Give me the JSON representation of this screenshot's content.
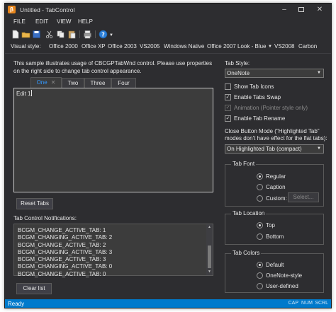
{
  "window": {
    "title": "Untitled - TabControl"
  },
  "menu": [
    "FILE",
    "EDIT",
    "VIEW",
    "HELP"
  ],
  "toolbar": {
    "icons": [
      "new-file-icon",
      "open-folder-icon",
      "save-icon",
      "cut-icon",
      "copy-icon",
      "paste-icon",
      "print-icon",
      "about-icon"
    ]
  },
  "visual_style": {
    "label": "Visual style:",
    "options": [
      "Office 2000",
      "Office XP",
      "Office 2003",
      "VS2005",
      "Windows Native",
      "Office 2007 Look - Blue",
      "VS2008",
      "Carbon"
    ]
  },
  "description": "This sample illustrates usage of CBCGPTabWnd control. Please use properties on the right side to change tab control appearance.",
  "tabs": [
    {
      "label": "One",
      "active": true
    },
    {
      "label": "Two",
      "active": false
    },
    {
      "label": "Three",
      "active": false
    },
    {
      "label": "Four",
      "active": false
    }
  ],
  "editor_text": "Edit 1",
  "reset_tabs_label": "Reset Tabs",
  "notifications": {
    "label": "Tab Control Notifications:",
    "items": [
      "BCGM_CHANGE_ACTIVE_TAB: 1",
      "BCGM_CHANGING_ACTIVE_TAB: 2",
      "BCGM_CHANGE_ACTIVE_TAB: 2",
      "BCGM_CHANGING_ACTIVE_TAB: 3",
      "BCGM_CHANGE_ACTIVE_TAB: 3",
      "BCGM_CHANGING_ACTIVE_TAB: 0",
      "BCGM_CHANGE_ACTIVE_TAB: 0"
    ]
  },
  "clear_list_label": "Clear list",
  "props": {
    "tab_style_label": "Tab Style:",
    "tab_style_value": "OneNote",
    "show_tab_icons": {
      "label": "Show Tab Icons",
      "checked": false
    },
    "enable_tabs_swap": {
      "label": "Enable Tabs Swap",
      "checked": true
    },
    "animation": {
      "label": "Animation (Pointer style only)",
      "checked": true
    },
    "enable_tab_rename": {
      "label": "Enable Tab Rename",
      "checked": true
    },
    "close_mode_label_1": "Close Button Mode (\"Highlighted Tab\"",
    "close_mode_label_2": "modes don't have effect for the flat tabs):",
    "close_mode_value": "On Highlighted Tab (compact)",
    "tab_font": {
      "title": "Tab Font",
      "options": [
        "Regular",
        "Caption",
        "Custom:"
      ],
      "selected": "Regular",
      "select_button": "Select..."
    },
    "tab_location": {
      "title": "Tab Location",
      "options": [
        "Top",
        "Bottom"
      ],
      "selected": "Top"
    },
    "tab_colors": {
      "title": "Tab Colors",
      "options": [
        "Default",
        "OneNote-style",
        "User-defined"
      ],
      "selected": "Default"
    }
  },
  "status": {
    "text": "Ready",
    "indicators": [
      "CAP",
      "NUM",
      "SCRL"
    ]
  },
  "colors": {
    "accent": "#007acc",
    "background": "#2d2d30",
    "active_tab_text": "#3399ff"
  }
}
